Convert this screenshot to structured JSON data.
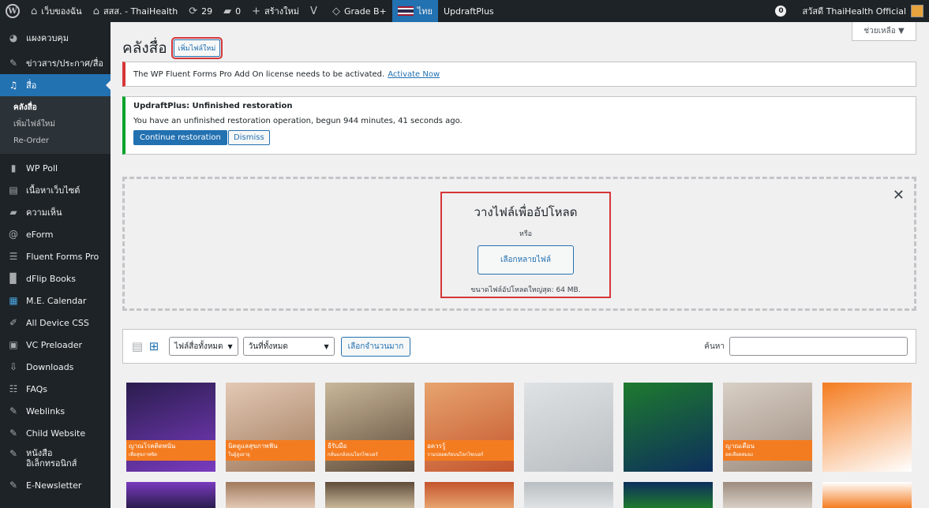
{
  "adminbar": {
    "site_name": "เว็บของฉัน",
    "site2": "สสส. - ThaiHealth",
    "updates": "29",
    "comments": "0",
    "new_label": "สร้างใหม่",
    "grade": "Grade B+",
    "lang": "ไทย",
    "updraft": "UpdraftPlus",
    "notif_count": "0",
    "greeting": "สวัสดี ThaiHealth Official"
  },
  "sidebar": {
    "items_top": [
      {
        "label": "แผงควบคุม",
        "icon": "dashboard-icon"
      },
      {
        "label": "ข่าวสาร/ประกาศ/สื่อ",
        "icon": "pin-icon"
      },
      {
        "label": "สื่อ",
        "icon": "media-icon"
      }
    ],
    "submenu": [
      "คลังสื่อ",
      "เพิ่มไฟล์ใหม่",
      "Re-Order"
    ],
    "items_bottom": [
      {
        "label": "WP Poll",
        "icon": "poll-icon"
      },
      {
        "label": "เนื้อหาเว็บไซต์",
        "icon": "page-icon"
      },
      {
        "label": "ความเห็น",
        "icon": "comment-icon"
      },
      {
        "label": "eForm",
        "icon": "eform-icon"
      },
      {
        "label": "Fluent Forms Pro",
        "icon": "form-icon"
      },
      {
        "label": "dFlip Books",
        "icon": "book-icon"
      },
      {
        "label": "M.E. Calendar",
        "icon": "calendar-icon"
      },
      {
        "label": "All Device CSS",
        "icon": "device-icon"
      },
      {
        "label": "VC Preloader",
        "icon": "preloader-icon"
      },
      {
        "label": "Downloads",
        "icon": "download-icon"
      },
      {
        "label": "FAQs",
        "icon": "faq-icon"
      },
      {
        "label": "Weblinks",
        "icon": "pin-icon"
      },
      {
        "label": "Child Website",
        "icon": "pin-icon"
      }
    ],
    "ebook_line1": "หนังสือ",
    "ebook_line2": "อิเล็กทรอนิกส์",
    "newsletter": "E-Newsletter"
  },
  "main": {
    "help": "ช่วยเหลือ ▼",
    "title": "คลังสื่อ",
    "add_new": "เพิ่มไฟล์ใหม่",
    "error_notice": "The WP Fluent Forms Pro Add On license needs to be activated.",
    "error_link": "Activate Now",
    "updraft_title": "UpdraftPlus: Unfinished restoration",
    "updraft_text": "You have an unfinished restoration operation, begun 944 minutes, 41 seconds ago.",
    "continue_btn": "Continue restoration",
    "dismiss_btn": "Dismiss",
    "upload_title": "วางไฟล์เพื่ออัปโหลด",
    "upload_or": "หรือ",
    "upload_btn": "เลือกหลายไฟล์",
    "upload_max": "ขนาดไฟล์อัปโหลดใหญ่สุด: 64 MB.",
    "filter_type": "ไฟล์สื่อทั้งหมด",
    "filter_date": "วันที่ทั้งหมด",
    "bulk": "เลือกจำนวนมาก",
    "search_label": "ค้นหา"
  },
  "thumbs": [
    {
      "caption": "ญาณโรคติดพนัน",
      "sub": "เพื่อสุขภาพจิต",
      "colors": [
        "#2a1d4e",
        "#7a3bbf"
      ]
    },
    {
      "caption": "นิคดูแลสุขภาพฟัน",
      "sub": "ในผู้สูงอายุ",
      "colors": [
        "#e3c9b5",
        "#a07a5c"
      ]
    },
    {
      "caption": "ธีรับมือ",
      "sub": "กลั่นแกล้งบนโลกไซเบอร์",
      "colors": [
        "#c9b79a",
        "#5f4b39"
      ]
    },
    {
      "caption": "อควรรู้",
      "sub": "วามปลอดภัยบนโลกไซเบอร์",
      "colors": [
        "#e7a46e",
        "#c4552d"
      ]
    },
    {
      "caption": "",
      "sub": "",
      "colors": [
        "#dfe2e4",
        "#b9bec2"
      ]
    },
    {
      "caption": "",
      "sub": "",
      "colors": [
        "#1e7a2e",
        "#0d2f5c"
      ]
    },
    {
      "caption": "ญาณเตือน",
      "sub": "อดเลือดสมอง",
      "colors": [
        "#d8cfc6",
        "#9d8c7e"
      ]
    },
    {
      "caption": "",
      "sub": "",
      "colors": [
        "#f47c20",
        "#ffffff"
      ]
    }
  ]
}
